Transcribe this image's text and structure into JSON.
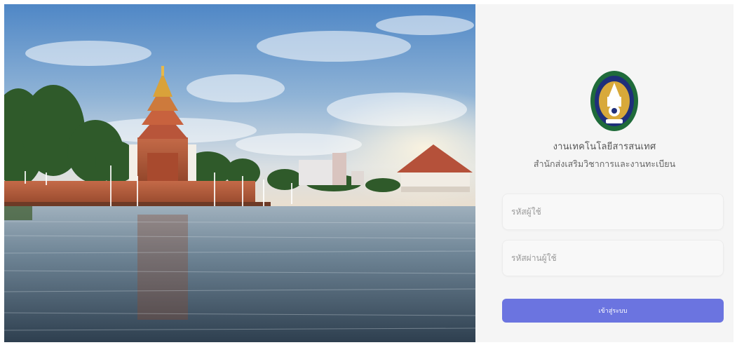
{
  "background": {
    "image_description": "",
    "scene": "pagoda-lake-campus"
  },
  "branding": {
    "logo_icon": "university-emblem-icon",
    "org_name": "งานเทคโนโลยีสารสนเทศ",
    "org_subtitle": "สำนักส่งเสริมวิชาการและงานทะเบียน"
  },
  "form": {
    "username": {
      "value": "",
      "placeholder": "รหัสผู้ใช้"
    },
    "password": {
      "value": "",
      "placeholder": "รหัสผ่านผู้ใช้"
    },
    "submit_label": "เข้าสู่ระบบ"
  },
  "colors": {
    "accent": "#6b74e0",
    "panel_background": "#f5f5f5",
    "emblem_green": "#1f6b3a",
    "emblem_blue": "#1f2f7a",
    "emblem_gold": "#d8a93a"
  }
}
